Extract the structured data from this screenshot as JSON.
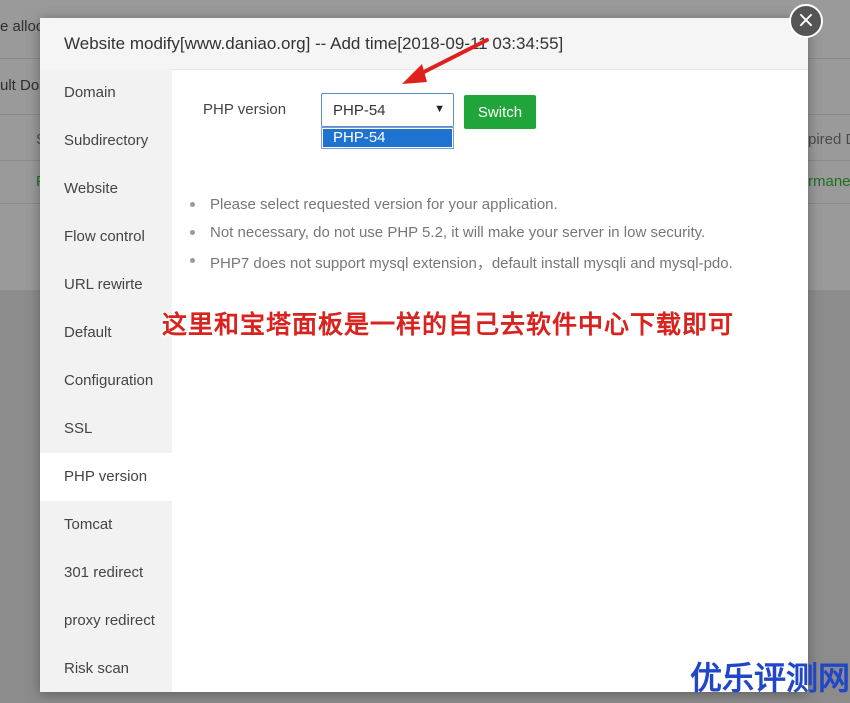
{
  "background": {
    "fragments": [
      "e alloc",
      "ult Do",
      "S",
      "pired D",
      "F",
      "rmane"
    ]
  },
  "dialog": {
    "title": "Website modify[www.daniao.org] -- Add time[2018-09-11 03:34:55]",
    "close_symbol": "×",
    "sidebar": {
      "items": [
        {
          "label": "Domain"
        },
        {
          "label": "Subdirectory"
        },
        {
          "label": "Website"
        },
        {
          "label": "Flow control"
        },
        {
          "label": "URL rewirte"
        },
        {
          "label": "Default"
        },
        {
          "label": "Configuration"
        },
        {
          "label": "SSL"
        },
        {
          "label": "PHP version",
          "active": true
        },
        {
          "label": "Tomcat"
        },
        {
          "label": "301 redirect"
        },
        {
          "label": "proxy redirect"
        },
        {
          "label": "Risk scan"
        }
      ]
    },
    "php": {
      "label": "PHP version",
      "selected": "PHP-54",
      "options": [
        "PHP-54"
      ],
      "switch_label": "Switch"
    },
    "tips": [
      "Please select requested version for your application.",
      "Not necessary, do not use PHP 5.2, it will make your server in low security.",
      "PHP7 does not support mysql extension，default install mysqli and mysql-pdo."
    ]
  },
  "annotation": {
    "text": "这里和宝塔面板是一样的自己去软件中心下载即可",
    "color": "#d8231f"
  },
  "watermark": {
    "text": "优乐评测网",
    "color": "#2147c8"
  },
  "colors": {
    "accent_green": "#20a53a",
    "select_blue": "#1e73d0"
  }
}
